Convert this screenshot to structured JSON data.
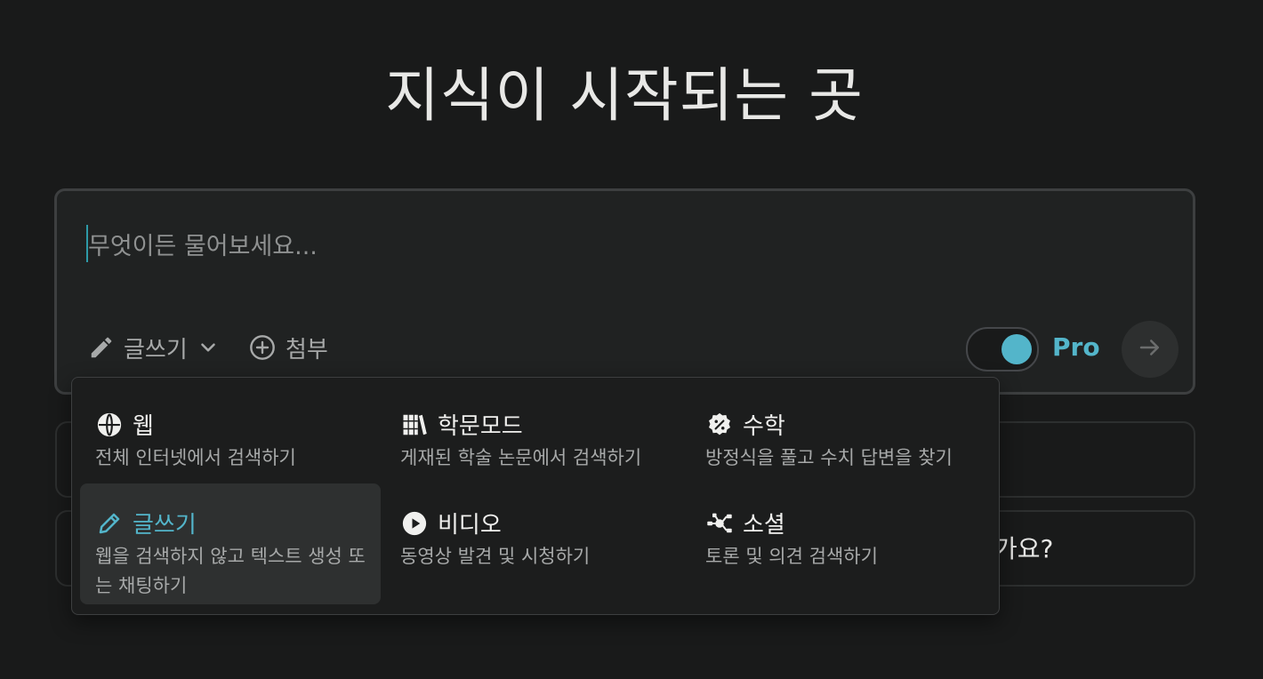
{
  "headline": "지식이 시작되는 곳",
  "search": {
    "placeholder": "무엇이든 물어보세요..."
  },
  "toolbar": {
    "focus_label": "글쓰기",
    "attach_label": "첨부",
    "pro_label": "Pro",
    "pro_enabled": true
  },
  "suggestions": {
    "partial_text": "가요?"
  },
  "focus_menu": {
    "options": [
      {
        "icon": "globe-icon",
        "title": "웹",
        "desc": "전체 인터넷에서 검색하기",
        "selected": false
      },
      {
        "icon": "library-icon",
        "title": "학문모드",
        "desc": "게재된 학술 논문에서 검색하기",
        "selected": false
      },
      {
        "icon": "math-icon",
        "title": "수학",
        "desc": "방정식을 풀고 수치 답변을 찾기",
        "selected": false
      },
      {
        "icon": "pencil-icon",
        "title": "글쓰기",
        "desc": "웹을 검색하지 않고 텍스트 생성 또는 채팅하기",
        "selected": true
      },
      {
        "icon": "play-icon",
        "title": "비디오",
        "desc": "동영상 발견 및 시청하기",
        "selected": false
      },
      {
        "icon": "social-icon",
        "title": "소셜",
        "desc": "토론 및 의견 검색하기",
        "selected": false
      }
    ]
  },
  "colors": {
    "background": "#191a1a",
    "accent": "#53b5ca",
    "muted_text": "#a7a9a9"
  }
}
